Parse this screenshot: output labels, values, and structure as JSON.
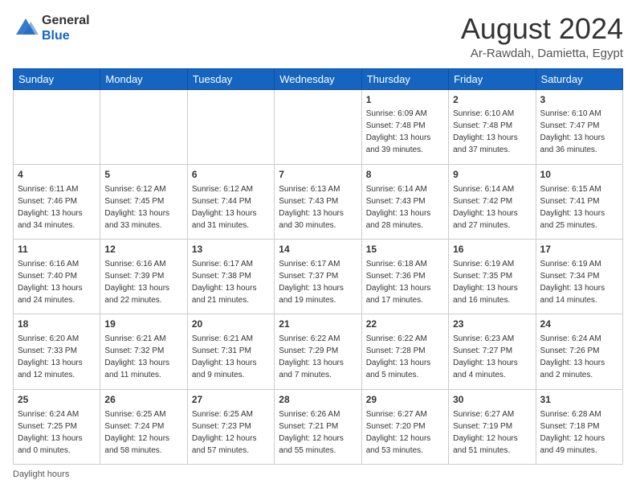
{
  "logo": {
    "general": "General",
    "blue": "Blue"
  },
  "header": {
    "month_year": "August 2024",
    "location": "Ar-Rawdah, Damietta, Egypt"
  },
  "days_of_week": [
    "Sunday",
    "Monday",
    "Tuesday",
    "Wednesday",
    "Thursday",
    "Friday",
    "Saturday"
  ],
  "weeks": [
    [
      {
        "day": "",
        "info": ""
      },
      {
        "day": "",
        "info": ""
      },
      {
        "day": "",
        "info": ""
      },
      {
        "day": "",
        "info": ""
      },
      {
        "day": "1",
        "sunrise": "Sunrise: 6:09 AM",
        "sunset": "Sunset: 7:48 PM",
        "daylight": "Daylight: 13 hours and 39 minutes."
      },
      {
        "day": "2",
        "sunrise": "Sunrise: 6:10 AM",
        "sunset": "Sunset: 7:48 PM",
        "daylight": "Daylight: 13 hours and 37 minutes."
      },
      {
        "day": "3",
        "sunrise": "Sunrise: 6:10 AM",
        "sunset": "Sunset: 7:47 PM",
        "daylight": "Daylight: 13 hours and 36 minutes."
      }
    ],
    [
      {
        "day": "4",
        "sunrise": "Sunrise: 6:11 AM",
        "sunset": "Sunset: 7:46 PM",
        "daylight": "Daylight: 13 hours and 34 minutes."
      },
      {
        "day": "5",
        "sunrise": "Sunrise: 6:12 AM",
        "sunset": "Sunset: 7:45 PM",
        "daylight": "Daylight: 13 hours and 33 minutes."
      },
      {
        "day": "6",
        "sunrise": "Sunrise: 6:12 AM",
        "sunset": "Sunset: 7:44 PM",
        "daylight": "Daylight: 13 hours and 31 minutes."
      },
      {
        "day": "7",
        "sunrise": "Sunrise: 6:13 AM",
        "sunset": "Sunset: 7:43 PM",
        "daylight": "Daylight: 13 hours and 30 minutes."
      },
      {
        "day": "8",
        "sunrise": "Sunrise: 6:14 AM",
        "sunset": "Sunset: 7:43 PM",
        "daylight": "Daylight: 13 hours and 28 minutes."
      },
      {
        "day": "9",
        "sunrise": "Sunrise: 6:14 AM",
        "sunset": "Sunset: 7:42 PM",
        "daylight": "Daylight: 13 hours and 27 minutes."
      },
      {
        "day": "10",
        "sunrise": "Sunrise: 6:15 AM",
        "sunset": "Sunset: 7:41 PM",
        "daylight": "Daylight: 13 hours and 25 minutes."
      }
    ],
    [
      {
        "day": "11",
        "sunrise": "Sunrise: 6:16 AM",
        "sunset": "Sunset: 7:40 PM",
        "daylight": "Daylight: 13 hours and 24 minutes."
      },
      {
        "day": "12",
        "sunrise": "Sunrise: 6:16 AM",
        "sunset": "Sunset: 7:39 PM",
        "daylight": "Daylight: 13 hours and 22 minutes."
      },
      {
        "day": "13",
        "sunrise": "Sunrise: 6:17 AM",
        "sunset": "Sunset: 7:38 PM",
        "daylight": "Daylight: 13 hours and 21 minutes."
      },
      {
        "day": "14",
        "sunrise": "Sunrise: 6:17 AM",
        "sunset": "Sunset: 7:37 PM",
        "daylight": "Daylight: 13 hours and 19 minutes."
      },
      {
        "day": "15",
        "sunrise": "Sunrise: 6:18 AM",
        "sunset": "Sunset: 7:36 PM",
        "daylight": "Daylight: 13 hours and 17 minutes."
      },
      {
        "day": "16",
        "sunrise": "Sunrise: 6:19 AM",
        "sunset": "Sunset: 7:35 PM",
        "daylight": "Daylight: 13 hours and 16 minutes."
      },
      {
        "day": "17",
        "sunrise": "Sunrise: 6:19 AM",
        "sunset": "Sunset: 7:34 PM",
        "daylight": "Daylight: 13 hours and 14 minutes."
      }
    ],
    [
      {
        "day": "18",
        "sunrise": "Sunrise: 6:20 AM",
        "sunset": "Sunset: 7:33 PM",
        "daylight": "Daylight: 13 hours and 12 minutes."
      },
      {
        "day": "19",
        "sunrise": "Sunrise: 6:21 AM",
        "sunset": "Sunset: 7:32 PM",
        "daylight": "Daylight: 13 hours and 11 minutes."
      },
      {
        "day": "20",
        "sunrise": "Sunrise: 6:21 AM",
        "sunset": "Sunset: 7:31 PM",
        "daylight": "Daylight: 13 hours and 9 minutes."
      },
      {
        "day": "21",
        "sunrise": "Sunrise: 6:22 AM",
        "sunset": "Sunset: 7:29 PM",
        "daylight": "Daylight: 13 hours and 7 minutes."
      },
      {
        "day": "22",
        "sunrise": "Sunrise: 6:22 AM",
        "sunset": "Sunset: 7:28 PM",
        "daylight": "Daylight: 13 hours and 5 minutes."
      },
      {
        "day": "23",
        "sunrise": "Sunrise: 6:23 AM",
        "sunset": "Sunset: 7:27 PM",
        "daylight": "Daylight: 13 hours and 4 minutes."
      },
      {
        "day": "24",
        "sunrise": "Sunrise: 6:24 AM",
        "sunset": "Sunset: 7:26 PM",
        "daylight": "Daylight: 13 hours and 2 minutes."
      }
    ],
    [
      {
        "day": "25",
        "sunrise": "Sunrise: 6:24 AM",
        "sunset": "Sunset: 7:25 PM",
        "daylight": "Daylight: 13 hours and 0 minutes."
      },
      {
        "day": "26",
        "sunrise": "Sunrise: 6:25 AM",
        "sunset": "Sunset: 7:24 PM",
        "daylight": "Daylight: 12 hours and 58 minutes."
      },
      {
        "day": "27",
        "sunrise": "Sunrise: 6:25 AM",
        "sunset": "Sunset: 7:23 PM",
        "daylight": "Daylight: 12 hours and 57 minutes."
      },
      {
        "day": "28",
        "sunrise": "Sunrise: 6:26 AM",
        "sunset": "Sunset: 7:21 PM",
        "daylight": "Daylight: 12 hours and 55 minutes."
      },
      {
        "day": "29",
        "sunrise": "Sunrise: 6:27 AM",
        "sunset": "Sunset: 7:20 PM",
        "daylight": "Daylight: 12 hours and 53 minutes."
      },
      {
        "day": "30",
        "sunrise": "Sunrise: 6:27 AM",
        "sunset": "Sunset: 7:19 PM",
        "daylight": "Daylight: 12 hours and 51 minutes."
      },
      {
        "day": "31",
        "sunrise": "Sunrise: 6:28 AM",
        "sunset": "Sunset: 7:18 PM",
        "daylight": "Daylight: 12 hours and 49 minutes."
      }
    ]
  ],
  "footer": {
    "note": "Daylight hours"
  }
}
